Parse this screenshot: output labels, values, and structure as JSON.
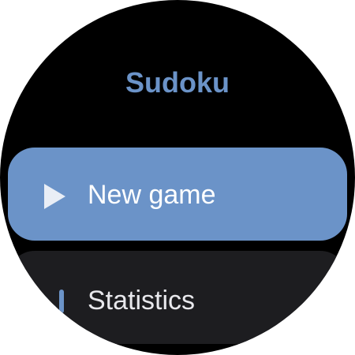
{
  "app": {
    "title": "Sudoku"
  },
  "menu": {
    "new_game_label": "New game",
    "statistics_label": "Statistics"
  },
  "icons": {
    "new_game": "play-icon",
    "statistics": "bar-chart-icon"
  },
  "colors": {
    "accent": "#6b93c8",
    "background": "#000000",
    "secondary_chip": "#1d1d20",
    "text": "#ffffff"
  }
}
